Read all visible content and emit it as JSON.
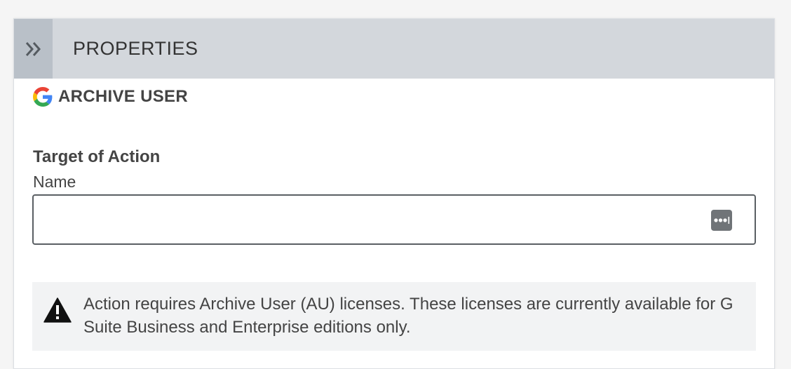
{
  "header": {
    "title": "PROPERTIES",
    "collapse_icon": "double-chevron-right-icon"
  },
  "action": {
    "icon": "google-g-icon",
    "title": "ARCHIVE USER"
  },
  "target": {
    "section_title": "Target of Action",
    "name_label": "Name",
    "name_value": "",
    "picker_icon": "more-dots-icon"
  },
  "warning": {
    "icon": "warning-triangle-icon",
    "text": "Action requires Archive User (AU) licenses. These licenses are currently available for G Suite Business and Enterprise editions only."
  },
  "colors": {
    "header_bg": "#d3d7dc",
    "collapse_bg": "#b9c0c8",
    "warning_bg": "#f2f3f4",
    "google_blue": "#4285F4",
    "google_red": "#EA4335",
    "google_yellow": "#FBBC05",
    "google_green": "#34A853"
  }
}
